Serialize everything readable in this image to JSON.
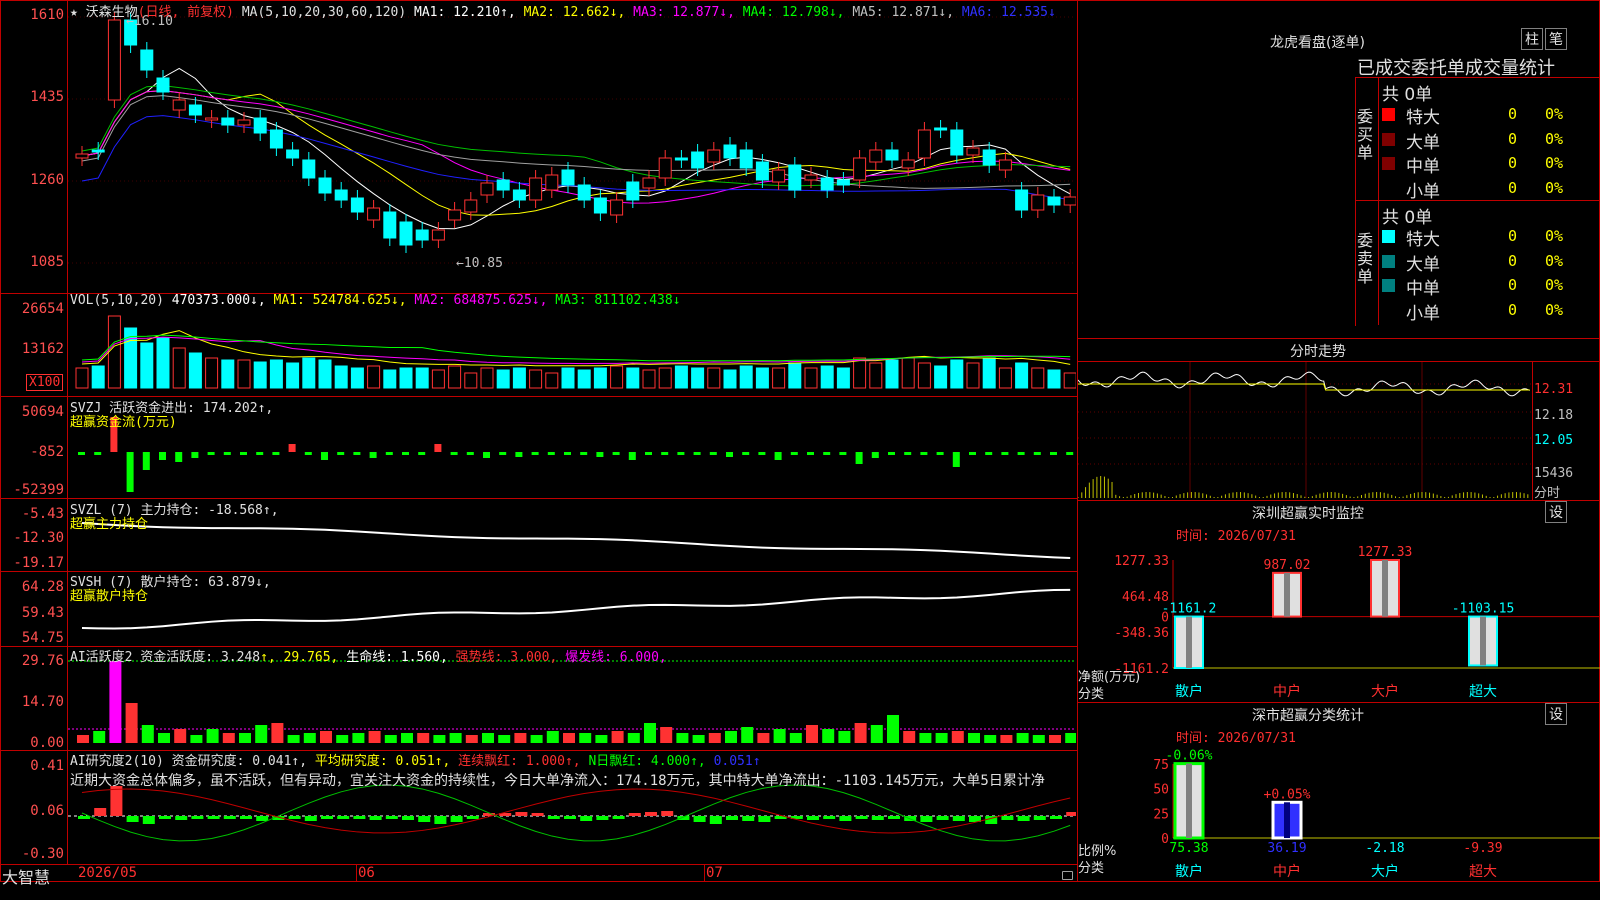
{
  "main_chart": {
    "title_star": "★",
    "stock_name": "沃森生物",
    "period": "(日线, 前复权)",
    "ma_label": "MA(5,10,20,30,60,120)",
    "ma1": "MA1: 12.210↑,",
    "ma2": "MA2: 12.662↓,",
    "ma3": "MA3: 12.877↓,",
    "ma4": "MA4: 12.798↓,",
    "ma5": "MA5: 12.871↓,",
    "ma6": "MA6: 12.535↓",
    "high_mark": "←16.10",
    "low_mark": "←10.85",
    "y_labels": [
      "1610",
      "1435",
      "1260",
      "1085"
    ]
  },
  "vol_panel": {
    "label": "VOL(5,10,20)",
    "value": "470373.000↓,",
    "ma1": "MA1: 524784.625↓,",
    "ma2": "MA2: 684875.625↓,",
    "ma3": "MA3: 811102.438↓",
    "y_labels": [
      "26654",
      "13162"
    ],
    "unit": "X100"
  },
  "svzj_panel": {
    "label": "SVZJ  活跃资金进出: 174.202↑,",
    "sublabel": "超赢资金流(万元)",
    "y_labels": [
      "50694",
      "-852",
      "-52399"
    ]
  },
  "svzl_panel": {
    "label": "SVZL (7) 主力持仓: -18.568↑,",
    "sublabel": "超赢主力持仓",
    "y_labels": [
      "-5.43",
      "-12.30",
      "-19.17"
    ]
  },
  "svsh_panel": {
    "label": "SVSH (7) 散户持仓: 63.879↓,",
    "sublabel": "超赢散户持仓",
    "y_labels": [
      "64.28",
      "59.43",
      "54.75"
    ]
  },
  "ai_active_panel": {
    "label": "AI活跃度2 资金活跃度: 3.248",
    "v2": "↑, 29.765,",
    "v3": "生命线: 1.560,",
    "v4": "强势线: 3.000,",
    "v5": "爆发线: 6.000,",
    "y_labels": [
      "29.76",
      "14.70",
      "0.00"
    ]
  },
  "ai_research_panel": {
    "label": "AI研究度2(10) 资金研究度: 0.041↑,",
    "v2": "平均研究度: 0.051↑,",
    "v3": "连续飘红: 1.000↑,",
    "v4": "N日飘红: 4.000↑,",
    "v5": "0.051↑",
    "comment": "近期大资金总体偏多，虽不活跃，但有异动，宜关注大资金的持续性，今日大单净流入：174.18万元，其中特大单净流出：-1103.145万元，大单5日累计净",
    "y_labels": [
      "0.41",
      "0.06",
      "-0.30"
    ]
  },
  "bottom_bar": {
    "brand": "大智慧",
    "months": [
      "2026/05",
      "06",
      "07"
    ]
  },
  "dragon_tiger": {
    "title": "龙虎看盘(逐单)",
    "btn1": "柱",
    "btn2": "笔",
    "subtitle": "已成交委托单成交量统计",
    "buy_label": "委买单",
    "sell_label": "委卖单",
    "buy_total": "共 0单",
    "sell_total": "共 0单",
    "buy_rows": [
      {
        "name": "特大",
        "count": "0",
        "pct": "0%",
        "color": "#ff0000"
      },
      {
        "name": "大单",
        "count": "0",
        "pct": "0%",
        "color": "#800000"
      },
      {
        "name": "中单",
        "count": "0",
        "pct": "0%",
        "color": "#800000"
      },
      {
        "name": "小单",
        "count": "0",
        "pct": "0%",
        "color": "#000000"
      }
    ],
    "sell_rows": [
      {
        "name": "特大",
        "count": "0",
        "pct": "0%",
        "color": "#00ffff"
      },
      {
        "name": "大单",
        "count": "0",
        "pct": "0%",
        "color": "#008080"
      },
      {
        "name": "中单",
        "count": "0",
        "pct": "0%",
        "color": "#008080"
      },
      {
        "name": "小单",
        "count": "0",
        "pct": "0%",
        "color": "#000000"
      }
    ]
  },
  "intraday": {
    "title": "分时走势",
    "price_labels": [
      "12.31",
      "12.18",
      "12.05"
    ],
    "vol_label": "15436",
    "unit": "分时"
  },
  "sz_monitor": {
    "title": "深圳超赢实时监控",
    "btn": "设",
    "date": "时间: 2026/07/31",
    "y_labels": [
      "1277.33",
      "464.48",
      "0",
      "-348.36",
      "-1161.2"
    ],
    "axis_title": "净额(万元)",
    "category_title": "分类",
    "categories": [
      "散户",
      "中户",
      "大户",
      "超大"
    ],
    "values": [
      -1161.2,
      987.02,
      1277.33,
      -1103.15
    ],
    "value_labels": [
      "-1161.2",
      "987.02",
      "1277.33",
      "-1103.15"
    ]
  },
  "sz_class": {
    "title": "深市超赢分类统计",
    "btn": "设",
    "date": "时间: 2026/07/31",
    "y_labels": [
      "75",
      "50",
      "25",
      "0"
    ],
    "axis_title": "比例%",
    "category_title": "分类",
    "categories": [
      "散户",
      "中户",
      "大户",
      "超大"
    ],
    "values": [
      75.38,
      36.19,
      -2.18,
      -9.39
    ],
    "value_labels": [
      "75.38",
      "36.19",
      "-2.18",
      "-9.39"
    ],
    "change_labels": [
      "-0.06%",
      "+0.05%"
    ]
  },
  "chart_data": [
    {
      "type": "bar",
      "title": "深圳超赢实时监控",
      "ylabel": "净额(万元)",
      "categories": [
        "散户",
        "中户",
        "大户",
        "超大"
      ],
      "values": [
        -1161.2,
        987.02,
        1277.33,
        -1103.15
      ],
      "ylim": [
        -1161.2,
        1277.33
      ]
    },
    {
      "type": "bar",
      "title": "深市超赢分类统计",
      "ylabel": "比例%",
      "categories": [
        "散户",
        "中户",
        "大户",
        "超大"
      ],
      "values": [
        75.38,
        36.19,
        -2.18,
        -9.39
      ],
      "ylim": [
        0,
        75
      ]
    }
  ]
}
